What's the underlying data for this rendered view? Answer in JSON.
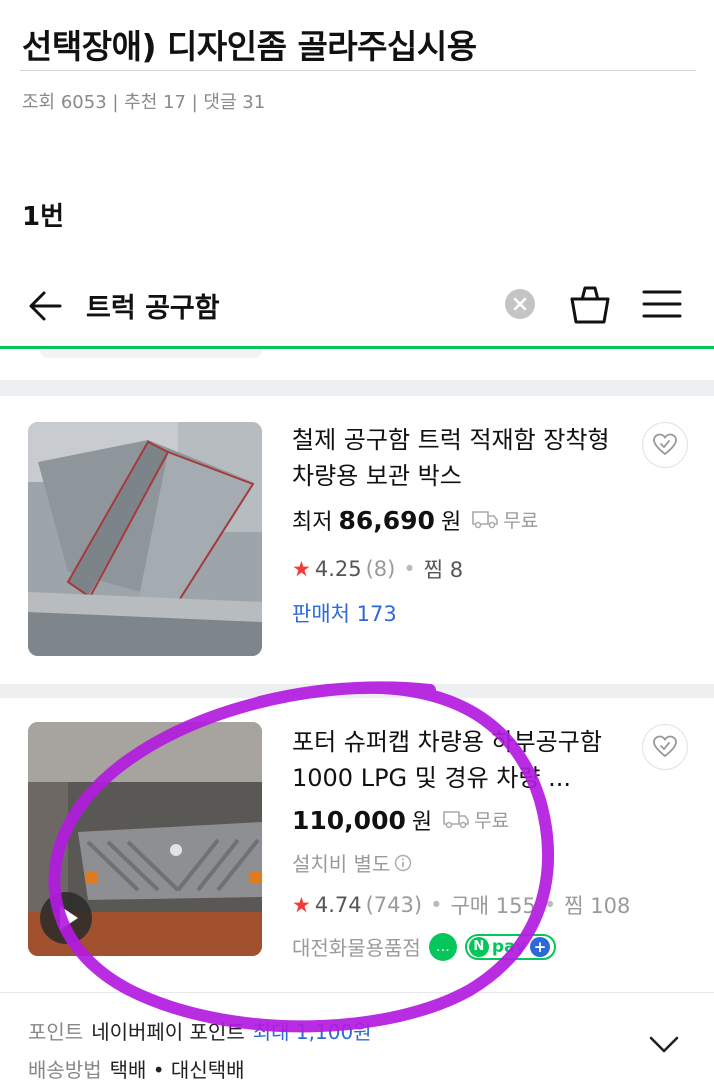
{
  "post": {
    "title": "선택장애) 디자인좀 골라주십시용",
    "meta": "조회 6053 | 추천 17 | 댓글 31",
    "label": "1번"
  },
  "app_bar": {
    "title": "트럭 공구함",
    "icons": [
      "back-arrow-icon",
      "clear-icon",
      "cart-icon",
      "menu-icon"
    ]
  },
  "colors": {
    "brand_green": "#03c75a",
    "link_blue": "#2d6ad8",
    "star_red": "#f23b3b",
    "annotation_purple": "#b31be0"
  },
  "products": [
    {
      "title": "철제 공구함 트럭 적재함 장착형 차량용 보관 박스",
      "price_lead": "최저",
      "price": "86,690",
      "price_unit": "원",
      "shipping": "무료",
      "rating": "4.25",
      "reviews": "(8)",
      "wish_label": "찜 8",
      "seller_link": "판매처 173"
    },
    {
      "title": "포터 슈퍼캡 차량용 하부공구함 1000 LPG 및 경유 차량 ...",
      "price": "110,000",
      "price_unit": "원",
      "shipping": "무료",
      "note": "설치비 별도",
      "rating": "4.74",
      "reviews": "(743)",
      "purchases": "구매 155",
      "wish_label": "찜 108",
      "seller": "대전화물용품점",
      "npay_label": "pay"
    }
  ],
  "bottom_sheet": {
    "point_label": "포인트",
    "point_value": "네이버페이 포인트",
    "point_accent": "최대 1,100원",
    "delivery_label": "배송방법",
    "delivery_value": "택배 • 대신택배"
  }
}
